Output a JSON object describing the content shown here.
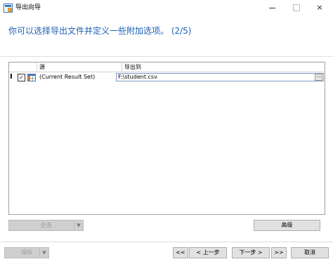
{
  "window": {
    "title": "导出向导",
    "icon": "wizard-icon",
    "controls": {
      "minimize": "minimize-icon",
      "maximize": "maximize-icon",
      "close_label": "×"
    }
  },
  "heading": "你可以选择导出文件并定义一些附加选项。 (2/5)",
  "grid": {
    "columns": [
      "源",
      "导出到"
    ],
    "rows": [
      {
        "cursor": "I",
        "checked": "✓",
        "source": "(Current Result Set)",
        "destination": "F:\\student.csv",
        "browse_label": "···"
      }
    ]
  },
  "buttons": {
    "select_all": "全选",
    "advanced": "高级",
    "save": "保存",
    "first": "<<",
    "prev": "< 上一步",
    "next": "下一步 >",
    "last": ">>",
    "cancel": "取消",
    "dropdown_arrow": "▼"
  }
}
